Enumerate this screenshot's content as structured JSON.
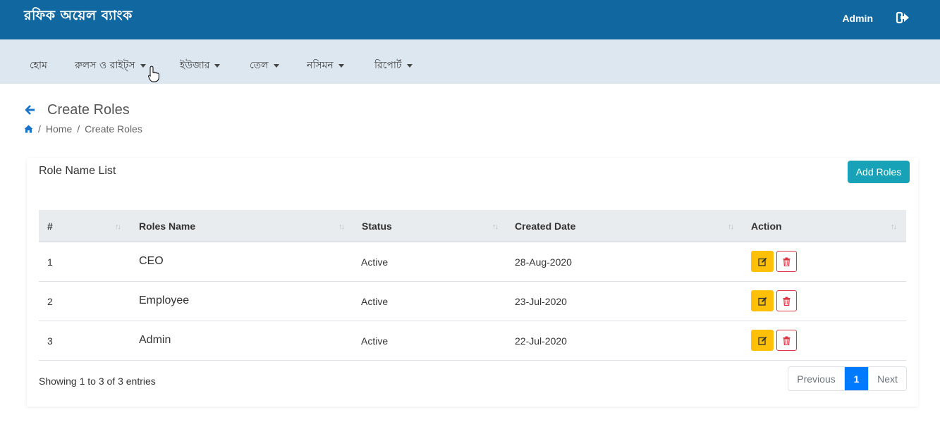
{
  "header": {
    "brand": "রফিক অয়েল ব্যাংক",
    "user": "Admin",
    "logout_icon": "sign-out-icon"
  },
  "nav": {
    "home": "হোম",
    "rules": "রুলস ও রাইট্স",
    "users": "ইউজার",
    "oil": "তেল",
    "nosimon": "নসিমন",
    "report": "রিপোর্ট"
  },
  "page": {
    "title": "Create Roles",
    "breadcrumb_home": "Home",
    "breadcrumb_current": "Create Roles"
  },
  "card": {
    "list_title": "Role Name List",
    "add_label": "Add Roles"
  },
  "table": {
    "headers": [
      "#",
      "Roles Name",
      "Status",
      "Created Date",
      "Action"
    ],
    "rows": [
      {
        "num": "1",
        "name": "CEO",
        "status": "Active",
        "date": "28-Aug-2020"
      },
      {
        "num": "2",
        "name": "Employee",
        "status": "Active",
        "date": "23-Jul-2020"
      },
      {
        "num": "3",
        "name": "Admin",
        "status": "Active",
        "date": "22-Jul-2020"
      }
    ]
  },
  "footer": {
    "showing": "Showing 1 to 3 of 3 entries",
    "prev": "Previous",
    "page": "1",
    "next": "Next"
  },
  "colors": {
    "topbar": "#1167a0",
    "navbar": "#dde7ef",
    "add_button": "#17a2b8",
    "edit_button": "#ffc107",
    "delete_border": "#dc3545",
    "active_page": "#007bff"
  }
}
